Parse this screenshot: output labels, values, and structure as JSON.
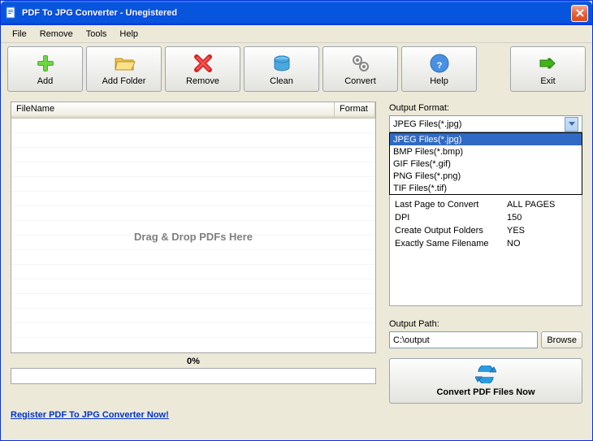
{
  "window": {
    "title": "PDF To JPG Converter - Unegistered"
  },
  "menubar": {
    "file": "File",
    "remove": "Remove",
    "tools": "Tools",
    "help": "Help"
  },
  "toolbar": {
    "add": "Add",
    "add_folder": "Add Folder",
    "remove": "Remove",
    "clean": "Clean",
    "convert": "Convert",
    "help": "Help",
    "exit": "Exit"
  },
  "table": {
    "col_filename": "FileName",
    "col_format": "Format",
    "dragdrop_hint": "Drag & Drop PDFs Here"
  },
  "progress": {
    "label": "0%"
  },
  "register_link": "Register PDF To JPG Converter Now!",
  "output_format": {
    "label": "Output Format:",
    "selected": "JPEG Files(*.jpg)",
    "options": [
      "JPEG Files(*.jpg)",
      "BMP Files(*.bmp)",
      "GIF Files(*.gif)",
      "PNG Files(*.png)",
      "TIF Files(*.tif)"
    ]
  },
  "settings": {
    "rows": [
      {
        "key": "Last Page to Convert",
        "val": "ALL PAGES"
      },
      {
        "key": "DPI",
        "val": "150"
      },
      {
        "key": "Create Output Folders",
        "val": "YES"
      },
      {
        "key": "Exactly Same Filename",
        "val": "NO"
      }
    ]
  },
  "output_path": {
    "label": "Output Path:",
    "value": "C:\\output",
    "browse": "Browse"
  },
  "convert_now": "Convert PDF Files Now"
}
